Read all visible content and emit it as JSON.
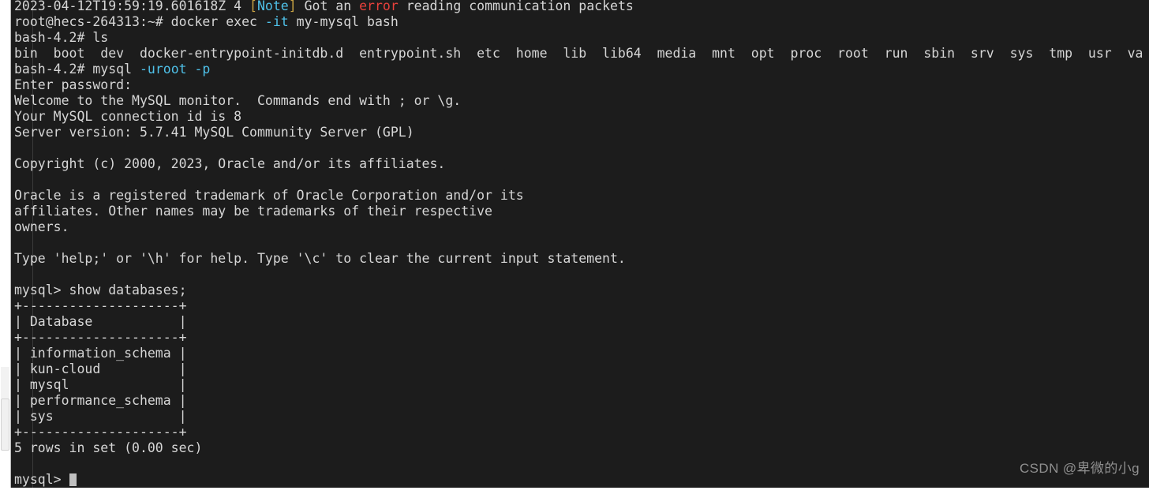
{
  "terminal": {
    "background_color": "#1c1c1c",
    "foreground_color": "#d6d6d6",
    "accent_cyan": "#4fc1e9",
    "accent_red": "#e8413c",
    "accent_yellow": "#c8a243",
    "cursor_color": "#bfbfbf",
    "lines": {
      "l00_a": "2023-04-12T19:59:19.601618Z 4 ",
      "l00_b": "[",
      "l00_c": "Note",
      "l00_d": "]",
      "l00_e": " Got an ",
      "l00_f": "error",
      "l00_g": " reading communication packets",
      "l01_a": "root@hecs-264313:~# docker exec ",
      "l01_b": "-it",
      "l01_c": " my-mysql bash",
      "l02": "bash-4.2# ls",
      "l03": "bin  boot  dev  docker-entrypoint-initdb.d  entrypoint.sh  etc  home  lib  lib64  media  mnt  opt  proc  root  run  sbin  srv  sys  tmp  usr  va",
      "l04_a": "bash-4.2# mysql ",
      "l04_b": "-uroot -p",
      "l05": "Enter password:",
      "l06": "Welcome to the MySQL monitor.  Commands end with ; or \\g.",
      "l07": "Your MySQL connection id is 8",
      "l08": "Server version: 5.7.41 MySQL Community Server (GPL)",
      "l09": "",
      "l10": "Copyright (c) 2000, 2023, Oracle and/or its affiliates.",
      "l11": "",
      "l12": "Oracle is a registered trademark of Oracle Corporation and/or its",
      "l13": "affiliates. Other names may be trademarks of their respective",
      "l14": "owners.",
      "l15": "",
      "l16": "Type 'help;' or '\\h' for help. Type '\\c' to clear the current input statement.",
      "l17": "",
      "l18": "mysql> show databases;",
      "l19": "+--------------------+",
      "l20": "| Database           |",
      "l21": "+--------------------+",
      "l22": "| information_schema |",
      "l23": "| kun-cloud          |",
      "l24": "| mysql              |",
      "l25": "| performance_schema |",
      "l26": "| sys                |",
      "l27": "+--------------------+",
      "l28": "5 rows in set (0.00 sec)",
      "l29": "",
      "l30": "mysql> "
    }
  },
  "query_result": {
    "command": "show databases;",
    "column_header": "Database",
    "rows": [
      "information_schema",
      "kun-cloud",
      "mysql",
      "performance_schema",
      "sys"
    ],
    "status": "5 rows in set (0.00 sec)",
    "row_count": 5,
    "elapsed_seconds": "0.00"
  },
  "session": {
    "host_prompt": "root@hecs-264313:~#",
    "container_prompt": "bash-4.2#",
    "mysql_prompt": "mysql>",
    "server_version": "5.7.41 MySQL Community Server (GPL)",
    "connection_id": "8"
  },
  "watermark": {
    "text": "CSDN @卑微的小g"
  }
}
